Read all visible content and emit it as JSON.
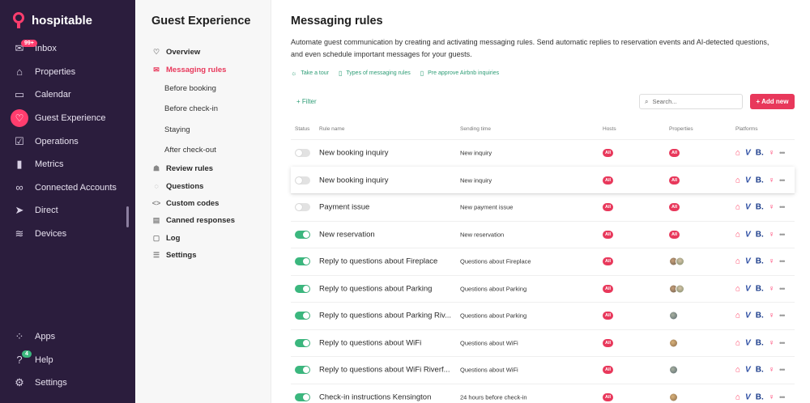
{
  "app": {
    "brand": "hospitable"
  },
  "leftnav": {
    "items": [
      {
        "label": "Inbox",
        "icon": "mail-icon",
        "badge": "99+"
      },
      {
        "label": "Properties",
        "icon": "home-icon"
      },
      {
        "label": "Calendar",
        "icon": "calendar-icon"
      },
      {
        "label": "Guest Experience",
        "icon": "heart-icon",
        "active": true
      },
      {
        "label": "Operations",
        "icon": "checkbox-icon"
      },
      {
        "label": "Metrics",
        "icon": "bar-chart-icon"
      },
      {
        "label": "Connected Accounts",
        "icon": "link-icon"
      },
      {
        "label": "Direct",
        "icon": "cursor-icon"
      },
      {
        "label": "Devices",
        "icon": "wifi-icon"
      }
    ],
    "bottom": [
      {
        "label": "Apps",
        "icon": "grid-icon"
      },
      {
        "label": "Help",
        "icon": "help-icon",
        "badge": "4"
      },
      {
        "label": "Settings",
        "icon": "gear-icon"
      }
    ]
  },
  "subnav": {
    "title": "Guest Experience",
    "items": [
      {
        "label": "Overview",
        "icon": "heart-outline-icon"
      },
      {
        "label": "Messaging rules",
        "icon": "mail-icon",
        "active": true
      },
      {
        "label": "Before booking",
        "child": true
      },
      {
        "label": "Before check-in",
        "child": true
      },
      {
        "label": "Staying",
        "child": true
      },
      {
        "label": "After check-out",
        "child": true
      },
      {
        "label": "Review rules",
        "icon": "reviews-icon"
      },
      {
        "label": "Questions",
        "icon": "question-icon"
      },
      {
        "label": "Custom codes",
        "icon": "code-icon"
      },
      {
        "label": "Canned responses",
        "icon": "canned-icon"
      },
      {
        "label": "Log",
        "icon": "log-icon"
      },
      {
        "label": "Settings",
        "icon": "settings-list-icon"
      }
    ]
  },
  "main": {
    "title": "Messaging rules",
    "description": "Automate guest communication by creating and activating messaging rules. Send automatic replies to reservation events and AI-detected questions, and even schedule important messages for your guests.",
    "links": [
      "Take a tour",
      "Types of messaging rules",
      "Pre approve Airbnb inquiries"
    ],
    "filter_label": "+ Filter",
    "search_placeholder": "Search...",
    "add_label": "+ Add new",
    "columns": {
      "status": "Status",
      "rule_name": "Rule name",
      "sending_time": "Sending time",
      "hosts": "Hosts",
      "properties": "Properties",
      "platforms": "Platforms"
    },
    "platform_marks": {
      "vrbo": "V",
      "booking": "B."
    },
    "rows": [
      {
        "active": false,
        "name": "New booking inquiry",
        "time": "New inquiry",
        "hosts": "All",
        "properties": "All"
      },
      {
        "active": false,
        "name": "New booking inquiry",
        "time": "New inquiry",
        "hosts": "All",
        "properties": "All"
      },
      {
        "active": false,
        "name": "Payment issue",
        "time": "New payment issue",
        "hosts": "All",
        "properties": "All"
      },
      {
        "active": true,
        "name": "New reservation",
        "time": "New reservation",
        "hosts": "All",
        "properties": "All"
      },
      {
        "active": true,
        "name": "Reply to questions about Fireplace",
        "time": "Questions about Fireplace",
        "hosts": "All",
        "properties": "thumbs-2"
      },
      {
        "active": true,
        "name": "Reply to questions about Parking",
        "time": "Questions about Parking",
        "hosts": "All",
        "properties": "thumbs-2"
      },
      {
        "active": true,
        "name": "Reply to questions about Parking Riv...",
        "time": "Questions about Parking",
        "hosts": "All",
        "properties": "thumbs-1"
      },
      {
        "active": true,
        "name": "Reply to questions about WiFi",
        "time": "Questions about WiFi",
        "hosts": "All",
        "properties": "thumbs-1b"
      },
      {
        "active": true,
        "name": "Reply to questions about WiFi Riverf...",
        "time": "Questions about WiFi",
        "hosts": "All",
        "properties": "thumbs-1"
      },
      {
        "active": true,
        "name": "Check-in instructions Kensington",
        "time": "24 hours before check-in",
        "hosts": "All",
        "properties": "thumbs-1b"
      }
    ]
  },
  "colors": {
    "sidebar": "#2b1d3d",
    "accent": "#e8385b",
    "green": "#3bb77e",
    "link": "#2e9d76"
  }
}
